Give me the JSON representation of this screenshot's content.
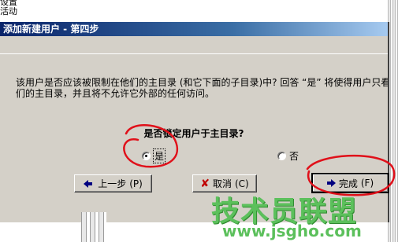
{
  "background_menu": {
    "item1": "设置",
    "item2": "活动"
  },
  "dialog": {
    "title": "添加新建用户 - 第四步",
    "description_line1": "该用户是否应该被限制在他们的主目录 (和它下面的子目录)中? 回答 “是” 将使得用户只看到",
    "description_line2": "们的主目录，并且将不允许它外部的任何访问。",
    "question": "是否锁定用户于主目录?",
    "radio_yes": {
      "label": "是",
      "checked": true
    },
    "radio_no": {
      "label": "否",
      "checked": false
    },
    "buttons": {
      "back": {
        "label": "上一步",
        "mnemonic": "(P)"
      },
      "cancel": {
        "label": "取消",
        "mnemonic": "(C)"
      },
      "finish": {
        "label": "完成",
        "mnemonic": "(F)"
      }
    }
  },
  "watermark": {
    "brand": "技术员联盟",
    "url": "www.jsgho.com"
  },
  "colors": {
    "dialog_bg": "#d4d0c8",
    "title_gradient_start": "#0a246a",
    "title_gradient_end": "#a6caf0",
    "annotation_red": "#e0101a",
    "watermark_green": "#5cc05c"
  },
  "icons": {
    "back": "arrow-left-icon",
    "cancel": "x-icon",
    "finish": "arrow-right-icon"
  }
}
